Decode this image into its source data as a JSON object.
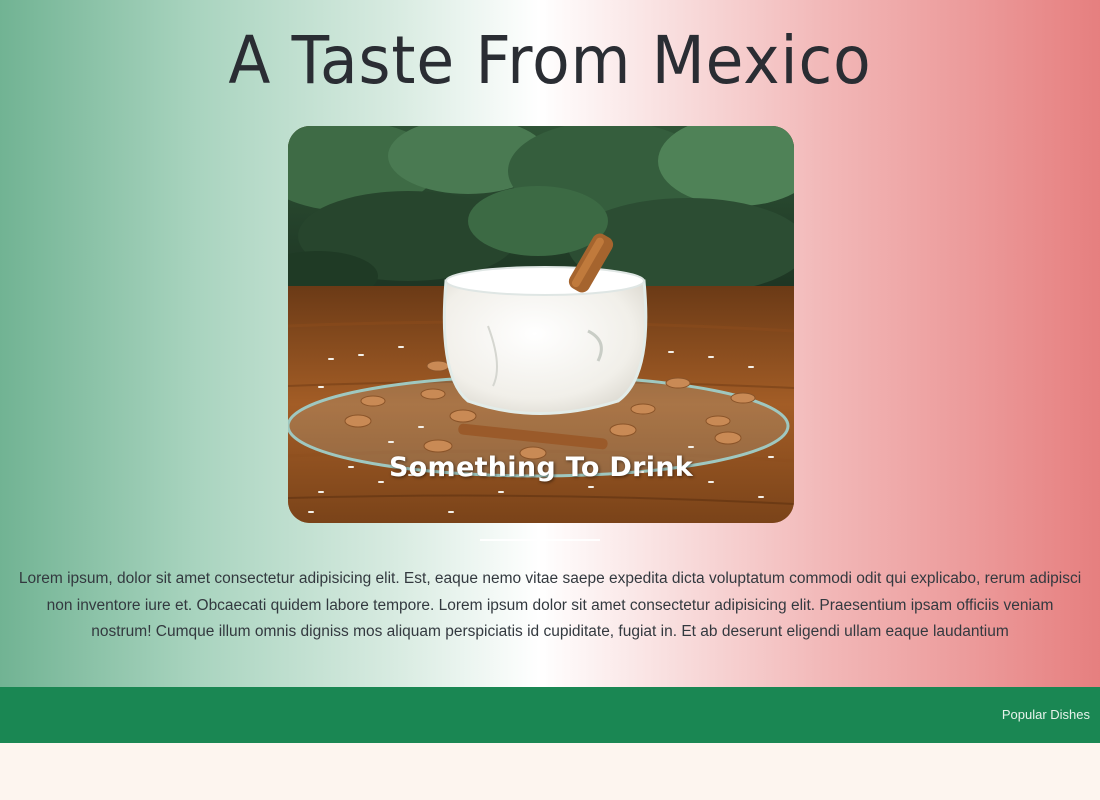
{
  "page": {
    "title": "A Taste From Mexico"
  },
  "feature": {
    "caption": "Something To Drink",
    "image_description_icon": "horchata-glass-photo"
  },
  "blurb": {
    "lines": [
      "Lorem ipsum, dolor sit amet consectetur adipisicing elit. Est, eaque nemo vitae saepe expedita dicta voluptatum commodi odit qui explicabo, rerum adipisci",
      "non inventore iure et. Obcaecati quidem labore tempore. Lorem ipsum dolor sit amet consectetur adipisicing elit. Praesentium ipsam officiis veniam",
      "nostrum! Cumque illum omnis digniss mos aliquam perspiciatis id cupiditate, fugiat in. Et ab deserunt eligendi ullam eaque laudantium"
    ]
  },
  "footer": {
    "link_label": "Popular Dishes"
  },
  "colors": {
    "gradient_left": "#71b393",
    "gradient_center": "#ffffff",
    "gradient_right": "#e67f7f",
    "footer_bar": "#1a8753",
    "page_background": "#fdf5ef"
  }
}
